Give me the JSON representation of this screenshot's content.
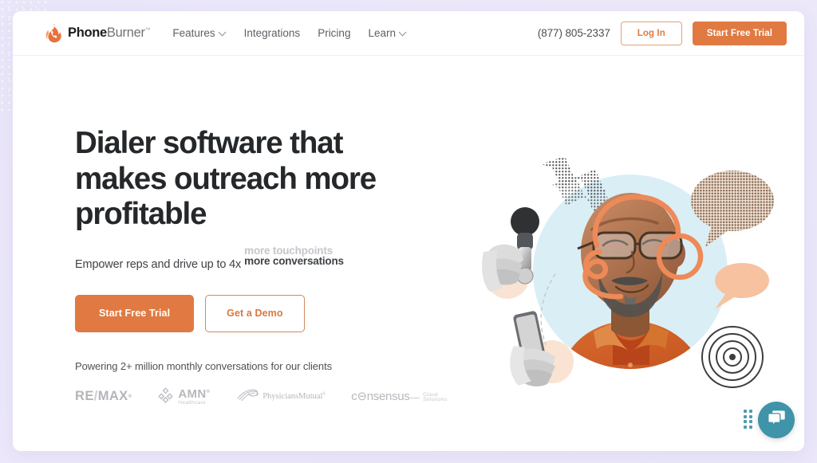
{
  "page": {
    "background_color": "#e9e5f8",
    "card_color": "#ffffff",
    "accent_color": "#e07a42",
    "chat_color": "#3f94a9"
  },
  "header": {
    "brand_bold": "Phone",
    "brand_light": "Burner",
    "brand_tm": "™",
    "logo_icon": "flame-phone-icon",
    "nav": [
      {
        "label": "Features",
        "has_dropdown": true
      },
      {
        "label": "Integrations",
        "has_dropdown": false
      },
      {
        "label": "Pricing",
        "has_dropdown": false
      },
      {
        "label": "Learn",
        "has_dropdown": true
      }
    ],
    "phone": "(877) 805-2337",
    "login_label": "Log In",
    "trial_label": "Start Free Trial"
  },
  "hero": {
    "headline": "Dialer software that makes outreach more profitable",
    "sub_prefix": "Empower reps and drive up to 4x",
    "rotator_previous": "more touchpoints",
    "rotator_current": "more conversations",
    "cta_primary": "Start Free Trial",
    "cta_secondary": "Get a Demo",
    "powering": "Powering 2+ million monthly conversations for our clients",
    "art_alt": "collage-illustration-man-with-headset"
  },
  "logos": [
    {
      "name": "RE/MAX",
      "part1": "RE",
      "slash": "/",
      "part2": "MAX",
      "tm": "®"
    },
    {
      "name": "AMN Healthcare",
      "title": "AMN",
      "tm": "®",
      "subtitle": "Healthcare"
    },
    {
      "name": "Physicians Mutual",
      "line1": "Physicians",
      "line2": "Mutual",
      "tm": "®"
    },
    {
      "name": "Consensus Cloud Solutions",
      "title": "c⊖nsensus",
      "subtitle": "Cloud Solutions"
    }
  ],
  "chat": {
    "button_name": "open-chat",
    "icon": "chat-bubbles-icon",
    "drag_handle": "chat-drag-handle"
  }
}
